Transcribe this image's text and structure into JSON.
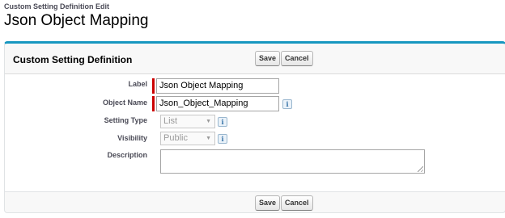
{
  "page": {
    "breadcrumb": "Custom Setting Definition Edit",
    "title": "Json Object Mapping"
  },
  "panel": {
    "title": "Custom Setting Definition",
    "save_label": "Save",
    "cancel_label": "Cancel"
  },
  "form": {
    "label": {
      "label": "Label",
      "value": "Json Object Mapping",
      "required": true
    },
    "object_name": {
      "label": "Object Name",
      "value": "Json_Object_Mapping",
      "required": true,
      "info_icon": "i"
    },
    "setting_type": {
      "label": "Setting Type",
      "selected": "List",
      "disabled": true,
      "info_icon": "i"
    },
    "visibility": {
      "label": "Visibility",
      "selected": "Public",
      "disabled": true,
      "info_icon": "i"
    },
    "description": {
      "label": "Description",
      "value": ""
    }
  },
  "colors": {
    "accent": "#1797c0",
    "required": "#cc0000",
    "label_text": "#4a4a56"
  },
  "icons": {
    "info": "info-icon",
    "select_arrow": "chevron-down-icon",
    "resize": "resize-grip-icon"
  }
}
